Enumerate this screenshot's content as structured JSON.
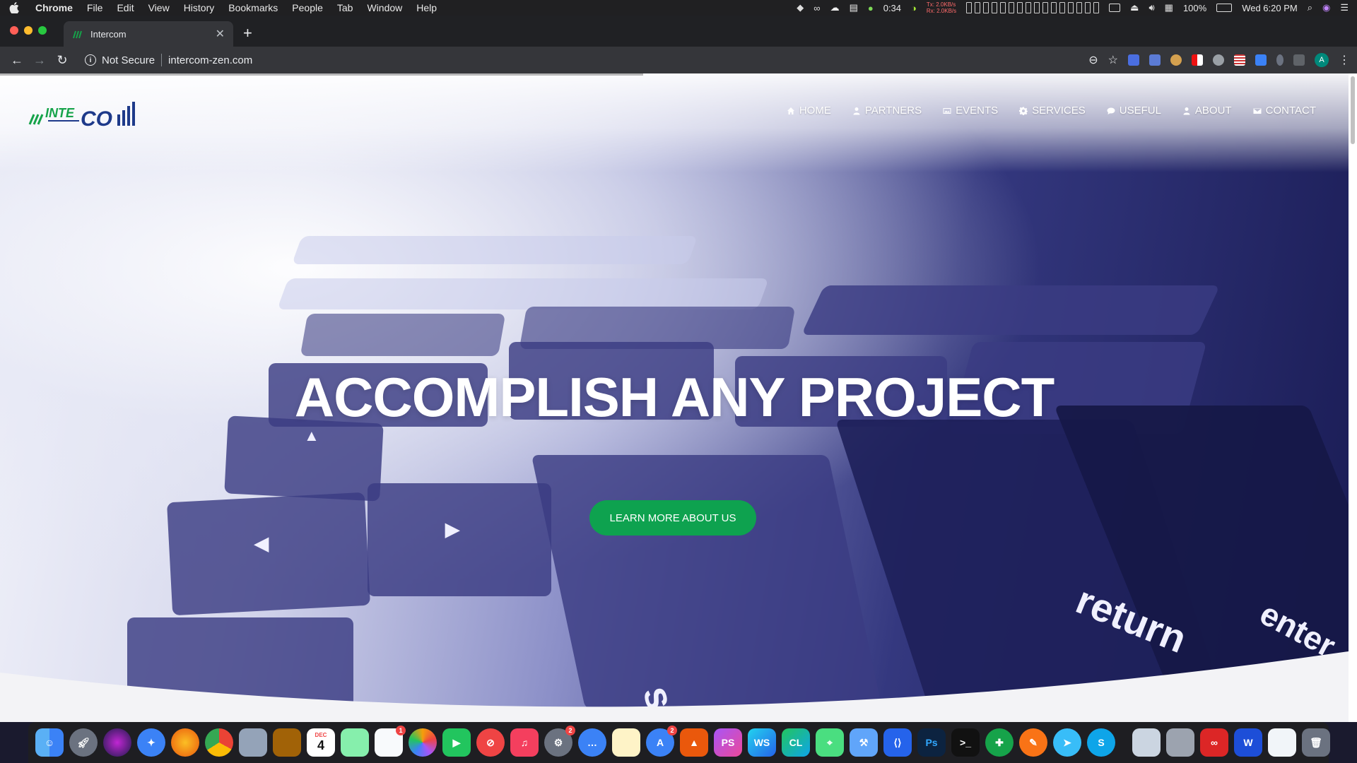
{
  "menubar": {
    "app": "Chrome",
    "items": [
      "File",
      "Edit",
      "View",
      "History",
      "Bookmarks",
      "People",
      "Tab",
      "Window",
      "Help"
    ],
    "timer": "0:34",
    "battery": "100%",
    "clock": "Wed 6:20 PM",
    "net_tx": "2.0KB/s",
    "net_rx": "2.0KB/s"
  },
  "tab": {
    "title": "Intercom",
    "new_tab": "+"
  },
  "toolbar": {
    "security": "Not Secure",
    "url": "intercom-zen.com",
    "avatar_letter": "A"
  },
  "nav": {
    "items": [
      {
        "label": "HOME",
        "icon": "home-icon"
      },
      {
        "label": "PARTNERS",
        "icon": "user-icon"
      },
      {
        "label": "EVENTS",
        "icon": "image-icon"
      },
      {
        "label": "SERVICES",
        "icon": "gear-icon"
      },
      {
        "label": "USEFUL",
        "icon": "comment-icon"
      },
      {
        "label": "ABOUT",
        "icon": "user-icon"
      },
      {
        "label": "CONTACT",
        "icon": "envelope-icon"
      }
    ]
  },
  "hero": {
    "headline": "ACCOMPLISH ANY PROJECT",
    "cta": "LEARN MORE ABOUT US",
    "key_labels": {
      "shift": "shift",
      "return": "return",
      "enter": "enter"
    }
  },
  "logo": {
    "text": "Intercom"
  },
  "colors": {
    "cta_green": "#0ea24f",
    "logo_blue": "#1e3a8a",
    "logo_green": "#16a34a",
    "hero_dark": "#1a1c55"
  },
  "dock": {
    "badges": {
      "reminders": "1",
      "system_prefs": "2",
      "app_store": "2"
    },
    "calendar_day": "4",
    "calendar_month": "DEC"
  }
}
